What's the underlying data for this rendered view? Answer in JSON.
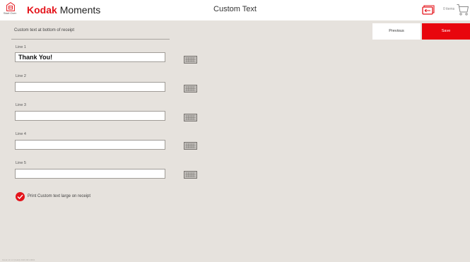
{
  "header": {
    "start_over_label": "Start Over",
    "brand_primary": "Kodak",
    "brand_secondary": "Moments",
    "title": "Custom Text",
    "items_count": "0 items",
    "accent_color": "#e4141b"
  },
  "section": {
    "title": "Custom text at bottom of receipt"
  },
  "actions": {
    "previous_label": "Previous",
    "save_label": "Save"
  },
  "fields": [
    {
      "label": "Line 1",
      "value": "Thank You!"
    },
    {
      "label": "Line 2",
      "value": ""
    },
    {
      "label": "Line 3",
      "value": ""
    },
    {
      "label": "Line 4",
      "value": ""
    },
    {
      "label": "Line 5",
      "value": ""
    }
  ],
  "large_text_option": {
    "label": "Print Custom text large on receipt",
    "checked": true
  },
  "footer": {
    "version": "Kiosk v3.1.0 (build) 2019.001.0001"
  },
  "icons": {
    "start_over": "home-icon",
    "orders": "orders-icon",
    "cart": "cart-icon",
    "keyboard": "keyboard-icon",
    "check": "check-icon"
  }
}
